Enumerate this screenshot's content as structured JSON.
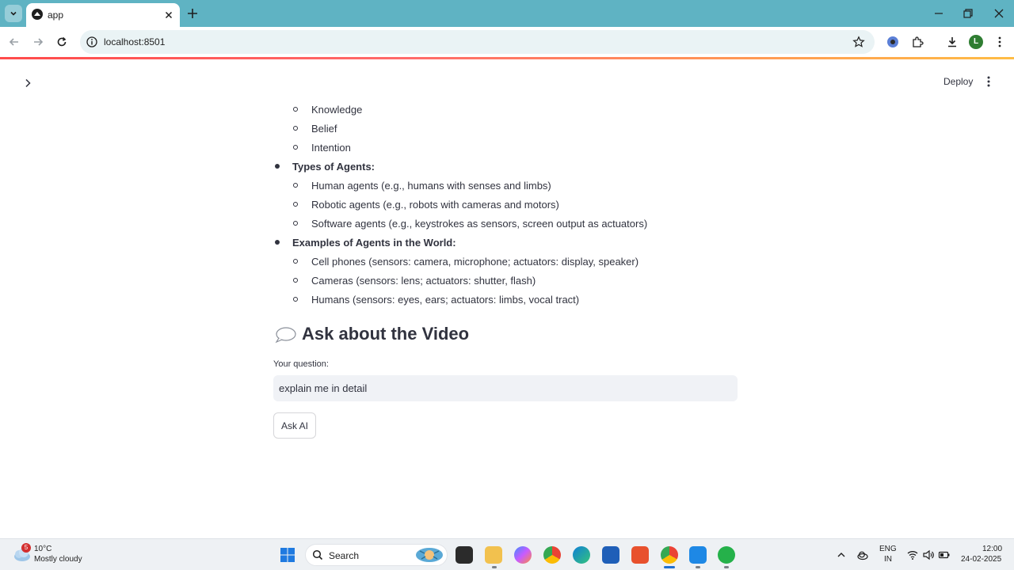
{
  "browser": {
    "tab_title": "app",
    "url": "localhost:8501",
    "profile_initial": "L"
  },
  "app": {
    "deploy_label": "Deploy",
    "list": {
      "items_top": [
        "Knowledge",
        "Belief",
        "Intention"
      ],
      "types_heading": "Types of Agents:",
      "types_items": [
        "Human agents (e.g., humans with senses and limbs)",
        "Robotic agents (e.g., robots with cameras and motors)",
        "Software agents (e.g., keystrokes as sensors, screen output as actuators)"
      ],
      "examples_heading": "Examples of Agents in the World:",
      "examples_items": [
        "Cell phones (sensors: camera, microphone; actuators: display, speaker)",
        "Cameras (sensors: lens; actuators: shutter, flash)",
        "Humans (sensors: eyes, ears; actuators: limbs, vocal tract)"
      ]
    },
    "section_heading": "Ask about the Video",
    "question_label": "Your question:",
    "question_value": "explain me in detail",
    "ask_button": "Ask AI"
  },
  "taskbar": {
    "weather_badge": "5",
    "weather_temp": "10°C",
    "weather_desc": "Mostly cloudy",
    "search_label": "Search",
    "lang_line1": "ENG",
    "lang_line2": "IN",
    "time": "12:00",
    "date": "24-02-2025"
  },
  "colors": {
    "tabstrip": "#5fb3c3",
    "accent": "#ff4b4b",
    "text": "#31333f",
    "input_bg": "#f0f2f6"
  }
}
